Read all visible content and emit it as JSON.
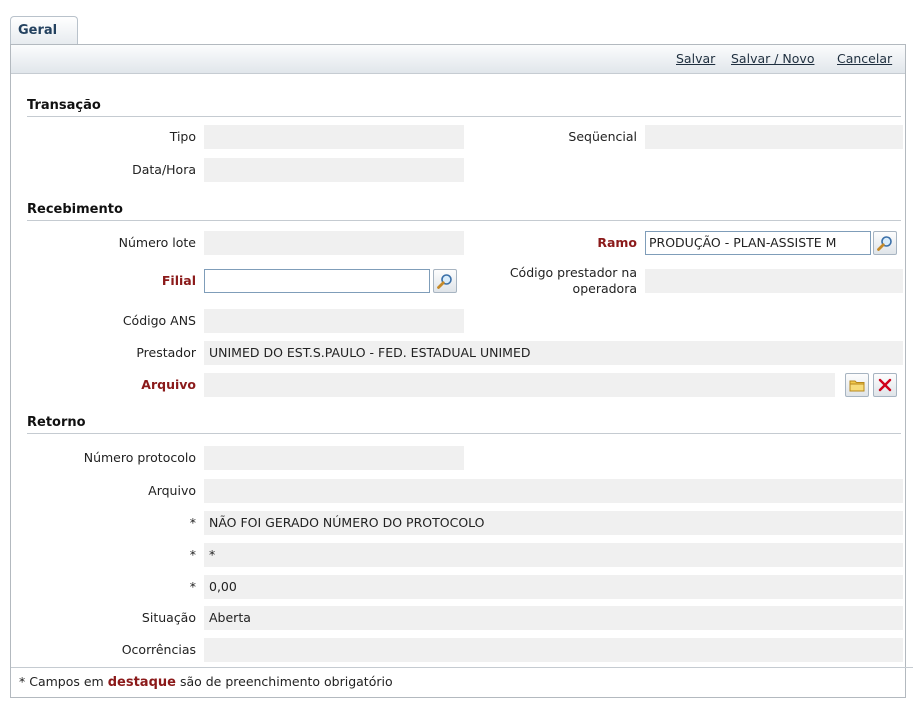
{
  "tabs": [
    {
      "label": "Geral"
    }
  ],
  "toolbar": {
    "save": "Salvar",
    "save_new": "Salvar / Novo",
    "cancel": "Cancelar"
  },
  "transacao": {
    "title": "Transação",
    "tipo_label": "Tipo",
    "tipo_value": "",
    "sequencial_label": "Seqüencial",
    "sequencial_value": "",
    "datahora_label": "Data/Hora",
    "datahora_value": ""
  },
  "recebimento": {
    "title": "Recebimento",
    "numero_lote_label": "Número lote",
    "numero_lote_value": "",
    "ramo_label": "Ramo",
    "ramo_value": "PRODUÇÃO - PLAN-ASSISTE M",
    "filial_label": "Filial",
    "filial_value": "",
    "codigo_prestador_label_1": "Código prestador na",
    "codigo_prestador_label_2": "operadora",
    "codigo_prestador_value": "",
    "codigo_ans_label": "Código ANS",
    "codigo_ans_value": "",
    "prestador_label": "Prestador",
    "prestador_value": "UNIMED DO EST.S.PAULO - FED. ESTADUAL UNIMED",
    "arquivo_label": "Arquivo",
    "arquivo_value": ""
  },
  "retorno": {
    "title": "Retorno",
    "numero_protocolo_label": "Número protocolo",
    "numero_protocolo_value": "",
    "arquivo_label": "Arquivo",
    "arquivo_value": "",
    "star1_label": "*",
    "star1_value": "NÃO FOI GERADO NÚMERO DO PROTOCOLO",
    "star2_label": "*",
    "star2_value": "*",
    "star3_label": "*",
    "star3_value": "0,00",
    "situacao_label": "Situação",
    "situacao_value": "Aberta",
    "ocorrencias_label": "Ocorrências",
    "ocorrencias_value": ""
  },
  "footer": {
    "prefix": "* Campos em",
    "highlight": "destaque",
    "suffix": "são de preenchimento obrigatório"
  },
  "icons": {
    "search": "magnifier-icon",
    "folder": "folder-icon",
    "delete": "red-x-icon"
  },
  "colors": {
    "required": "#8b1a1a",
    "field_bg": "#f0f0f0",
    "input_border": "#7f9db9"
  }
}
